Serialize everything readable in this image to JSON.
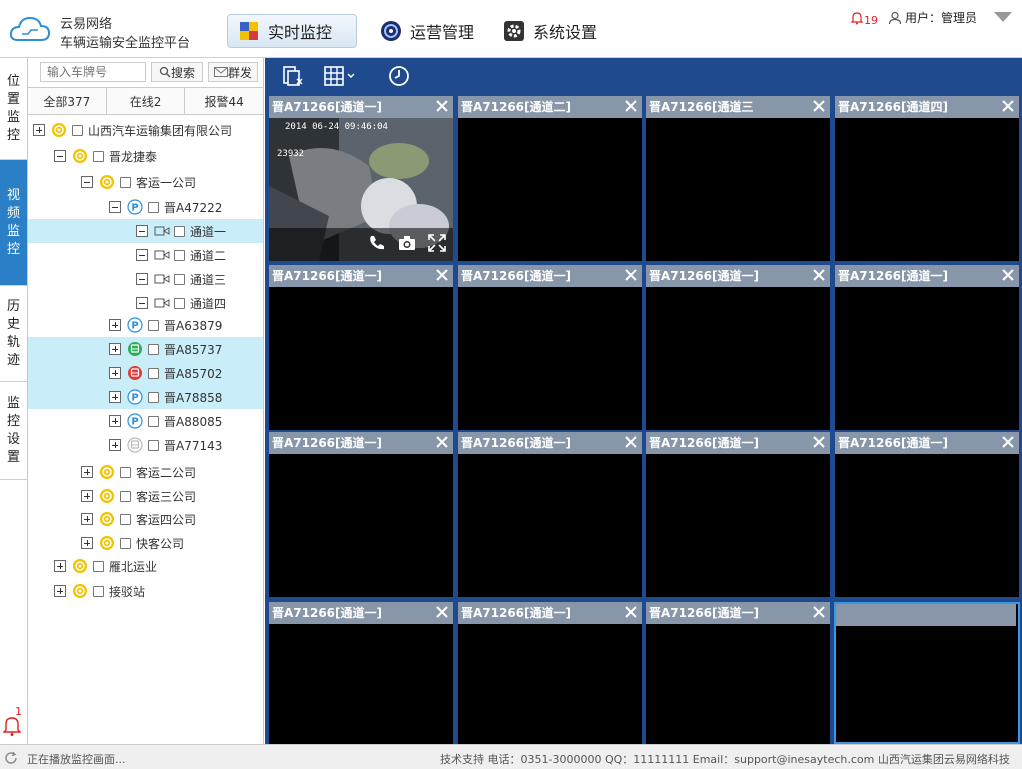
{
  "brand": {
    "name": "云易网络",
    "subtitle": "车辆运输安全监控平台"
  },
  "nav": {
    "realtime": "实时监控",
    "ops": "运营管理",
    "settings": "系统设置"
  },
  "header": {
    "alarm_count": "19",
    "user_label": "用户：",
    "user_name": "管理员"
  },
  "side_tabs": [
    "位置监控",
    "视频监控",
    "历史轨迹",
    "监控设置"
  ],
  "side_alarm_count": "1",
  "search": {
    "placeholder": "输入车牌号",
    "search_label": "搜索",
    "group_label": "群发"
  },
  "filters": {
    "all": "全部377",
    "online": "在线2",
    "alarm": "报警44"
  },
  "tree": {
    "root": "山西汽车运输集团有限公司",
    "jinlong": "晋龙捷泰",
    "keyun1": "客运一公司",
    "v1": "晋A47222",
    "ch1": "通道一",
    "ch2": "通道二",
    "ch3": "通道三",
    "ch4": "通道四",
    "v2": "晋A63879",
    "v3": "晋A85737",
    "v4": "晋A85702",
    "v5": "晋A78858",
    "v6": "晋A88085",
    "v7": "晋A77143",
    "keyun2": "客运二公司",
    "keyun3": "客运三公司",
    "keyun4": "客运四公司",
    "kuaike": "快客公司",
    "yanbei": "雁北运业",
    "jieboz": "接驳站"
  },
  "video_cells": [
    "晋A71266[通道一]",
    "晋A71266[通道二]",
    "晋A71266[通道三",
    "晋A71266[通道四]",
    "晋A71266[通道一]",
    "晋A71266[通道一]",
    "晋A71266[通道一]",
    "晋A71266[通道一]",
    "晋A71266[通道一]",
    "晋A71266[通道一]",
    "晋A71266[通道一]",
    "晋A71266[通道一]",
    "晋A71266[通道一]",
    "晋A71266[通道一]",
    "晋A71266[通道一]",
    ""
  ],
  "video_overlay": {
    "timestamp": "2014 06-24 09:46:04",
    "id": "23932"
  },
  "status": {
    "text": "正在播放监控画面...",
    "footer": "技术支持 电话：0351-3000000 QQ：11111111 Email：support@inesaytech.com 山西汽运集团云易网络科技"
  },
  "colors": {
    "accent": "#2b7fc6",
    "video_bg": "#1f4b8e",
    "cell_header": "#8796a8",
    "highlight_row": "#c9eefa"
  }
}
